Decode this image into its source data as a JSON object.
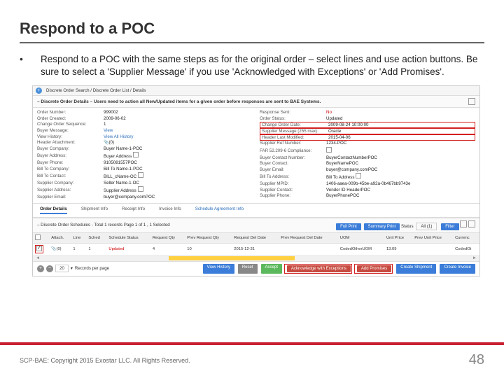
{
  "title": "Respond to a POC",
  "bullet": "Respond to a POC with the same steps as for the original order – select lines and use action buttons.  Be sure to select a 'Supplier Message' if you use 'Acknowledged with Exceptions' or 'Add Promises'.",
  "nav": {
    "breadcrumb": "Discrete Order Search / Discrete Order List / Details"
  },
  "section1": {
    "title": "– Discrete Order Details – Users need to action all New/Updated items for a given order before responses are sent to BAE Systems."
  },
  "left": [
    {
      "l": "Order Number:",
      "v": "999002"
    },
    {
      "l": "Order Created:",
      "v": "2009-06-02"
    },
    {
      "l": "Change Order Sequence:",
      "v": "1"
    },
    {
      "l": "Buyer Message:",
      "v": "View",
      "link": true
    },
    {
      "l": "View History:",
      "v": "View All History",
      "link": true
    },
    {
      "l": "Header Attachment:",
      "v": "(0)",
      "icon": "clip"
    },
    {
      "l": "Buyer Company:",
      "v": "Buyer Name-1-POC"
    },
    {
      "l": "Buyer Address:",
      "v": "Buyer Address",
      "copy": true
    },
    {
      "l": "Buyer Phone:",
      "v": "9105081557POC"
    },
    {
      "l": "Bill To Company:",
      "v": "Bill To Name-1-POC"
    },
    {
      "l": "Bill To Contact:",
      "v": "BILL_cName-OC",
      "copy": true
    },
    {
      "l": "Supplier Company:",
      "v": "Seller Name-1-OC"
    },
    {
      "l": "Supplier Address:",
      "v": "Supplier Address",
      "copy": true
    },
    {
      "l": "Supplier Email:",
      "v": "buyer@company.comPOC"
    }
  ],
  "right": [
    {
      "l": "Response Sent:",
      "v": "No",
      "red": true
    },
    {
      "l": "Order Status:",
      "v": "Updated"
    },
    {
      "l": "Change Order Date:",
      "v": "2009-08-24 10:00:00",
      "box": true
    },
    {
      "l": "Supplier Message (255 max):",
      "v": "Oracle",
      "box": true
    },
    {
      "l": "Header Last Modified:",
      "v": "2015-04-06",
      "box": true
    },
    {
      "l": "Supplier Ref Number:",
      "v": "1234-POC"
    },
    {
      "l": "FAR 52.209-6 Compliance:",
      "v": "",
      "chk": true
    },
    {
      "l": "Buyer Contact Number:",
      "v": "BuyerContactNumberPOC"
    },
    {
      "l": "Buyer Contact:",
      "v": "BuyerNamePOC"
    },
    {
      "l": "Buyer Email:",
      "v": "buyer@company.comPOC"
    },
    {
      "l": "Bill To Address:",
      "v": "Bill To Address",
      "copy": true
    },
    {
      "l": "Supplier MPID:",
      "v": "1406-aaea-009b-45be-a92a-0b467bb9743e"
    },
    {
      "l": "Supplier Contact:",
      "v": "Vendor ID HeaderPOC"
    },
    {
      "l": "Supplier Phone:",
      "v": "BuyerPhonePOC"
    }
  ],
  "tabs": [
    "Order Details",
    "Shipment Info",
    "Receipt Info",
    "Invoice Info",
    "Schedule Agreement Info"
  ],
  "schedules": {
    "title": "– Discrete Order Schedules - Total 1 records Page 1 of 1 , 1 Selected",
    "buttons": {
      "full": "Full Print",
      "summary": "Summary Print",
      "status": "Status",
      "statusVal": "All (1)",
      "filter": "Filter"
    }
  },
  "cols": [
    "Attach.",
    "Line",
    "Sched",
    "Schedule Status",
    "Request Qty",
    "Prev Request Qty",
    "Request Del Date",
    "Prev Request Del Date",
    "UOM",
    "Unit Price",
    "Prev Unit Price",
    "Currenc"
  ],
  "row": {
    "attach": "(0)",
    "line": "1",
    "sched": "1",
    "status": "Updated",
    "reqQty": "4",
    "prevQty": "10",
    "reqDate": "2015-12-31",
    "prevDate": "",
    "uom": "CodedOtherUOM",
    "price": "13.09",
    "prevPrice": "",
    "curr": "CodedOt"
  },
  "pagerSize": "20",
  "pagerText": "Records per page",
  "actions": [
    "View History",
    "Reset",
    "Accept",
    "Acknowledge with Exceptions",
    "Add Promises",
    "Create Shipment",
    "Create Invoice"
  ],
  "footer": {
    "copyright": "SCP-BAE:  Copyright 2015 Exostar LLC. All Rights Reserved.",
    "page": "48"
  }
}
